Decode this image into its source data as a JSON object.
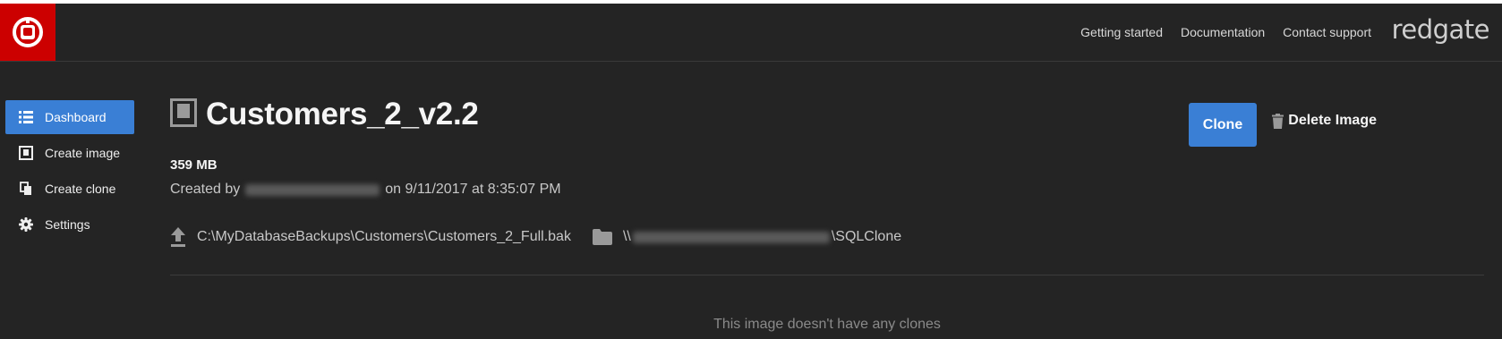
{
  "header": {
    "links": [
      "Getting started",
      "Documentation",
      "Contact support"
    ],
    "brand": "redgate",
    "logo_icon": "redgate-logo-icon",
    "logo_color": "#cc0000"
  },
  "sidebar": {
    "items": [
      {
        "label": "Dashboard",
        "icon": "list-icon",
        "active": true
      },
      {
        "label": "Create image",
        "icon": "image-icon",
        "active": false
      },
      {
        "label": "Create clone",
        "icon": "copy-icon",
        "active": false
      },
      {
        "label": "Settings",
        "icon": "gear-icon",
        "active": false
      }
    ],
    "active_color": "#3a7fd5"
  },
  "main": {
    "title": "Customers_2_v2.2",
    "size": "359 MB",
    "created_prefix": "Created by",
    "created_suffix": "on 9/11/2017 at 8:35:07 PM",
    "source_path": "C:\\MyDatabaseBackups\\Customers\\Customers_2_Full.bak",
    "dest_prefix": "\\\\",
    "dest_suffix": "\\SQLClone",
    "empty_message": "This image doesn't have any clones",
    "clone_button": "Clone",
    "delete_button": "Delete Image"
  }
}
